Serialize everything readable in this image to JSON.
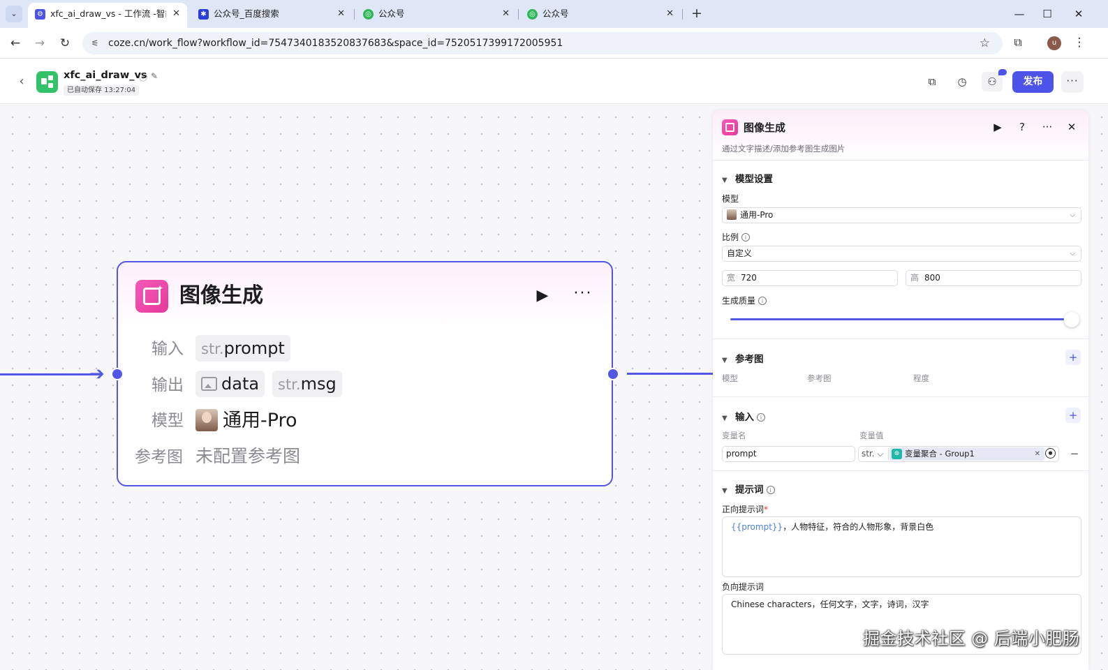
{
  "browser": {
    "tabs": [
      {
        "title": "xfc_ai_draw_vs - 工作流 -智能",
        "icon": "coze-icon",
        "active": true
      },
      {
        "title": "公众号_百度搜索",
        "icon": "baidu-paw-icon",
        "active": false
      },
      {
        "title": "公众号",
        "icon": "wechat-mp-icon",
        "active": false
      },
      {
        "title": "公众号",
        "icon": "wechat-mp-icon",
        "active": false
      }
    ],
    "url": "coze.cn/work_flow?workflow_id=7547340183520837683&space_id=7520517399172005951",
    "profile_initial": "u"
  },
  "header": {
    "workflow_name": "xfc_ai_draw_vs",
    "autosave": "已自动保存 13:27:04",
    "publish_label": "发布",
    "accent": "#4d53e8"
  },
  "node": {
    "title": "图像生成",
    "input_label": "输入",
    "inputs": [
      {
        "type": "str.",
        "name": "prompt"
      }
    ],
    "output_label": "输出",
    "outputs": [
      {
        "type": "image",
        "name": "data"
      },
      {
        "type": "str.",
        "name": "msg"
      }
    ],
    "model_label": "模型",
    "model_value": "通用-Pro",
    "ref_label": "参考图",
    "ref_value": "未配置参考图"
  },
  "panel": {
    "title": "图像生成",
    "description": "通过文字描述/添加参考图生成图片",
    "model_section": {
      "title": "模型设置",
      "model_label": "模型",
      "model_value": "通用-Pro",
      "ratio_label": "比例",
      "ratio_value": "自定义",
      "width_prefix": "宽",
      "width_value": "720",
      "height_prefix": "高",
      "height_value": "800",
      "quality_label": "生成质量",
      "quality_level": 1.0
    },
    "ref_section": {
      "title": "参考图",
      "columns": [
        "模型",
        "参考图",
        "程度"
      ]
    },
    "input_section": {
      "title": "输入",
      "col_name": "变量名",
      "col_value": "变量值",
      "var_name": "prompt",
      "var_type": "str.",
      "var_ref": "变量聚合 - Group1"
    },
    "prompt_section": {
      "title": "提示词",
      "positive_label": "正向提示词",
      "positive_ref": "{{prompt}}",
      "positive_text": "，人物特征，符合的人物形象，背景白色",
      "negative_label": "负向提示词",
      "negative_text": "Chinese characters，任何文字，文字，诗词，汉字"
    }
  },
  "watermark": "掘金技术社区 @ 后端小肥肠"
}
